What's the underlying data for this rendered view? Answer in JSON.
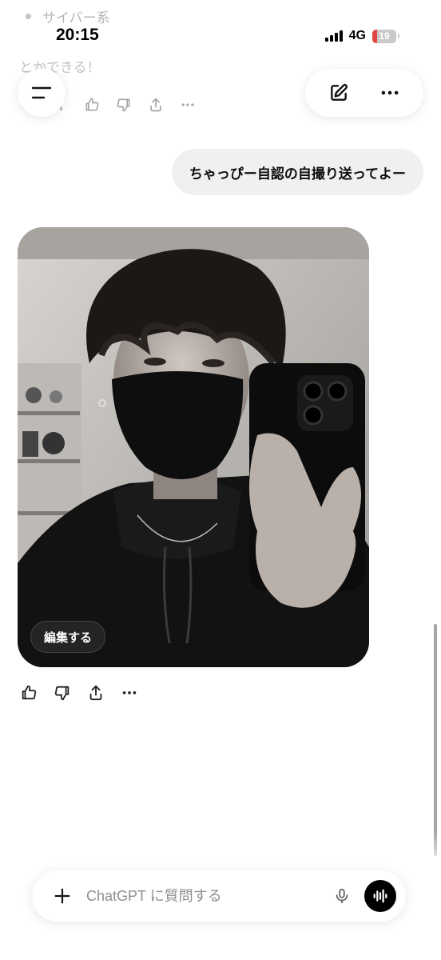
{
  "status": {
    "time": "20:15",
    "network": "4G",
    "battery": "19",
    "battery_level": 0.19,
    "battery_color": "#e04545"
  },
  "previous_message": {
    "bullet_text": "サイバー系",
    "tail_text": "とかできる！"
  },
  "header": {
    "menu_icon": "menu-icon",
    "new_chat_icon": "new-chat-icon",
    "more_icon": "more-icon"
  },
  "conversation": {
    "user_message": "ちゃっぴー自認の自撮り送ってよー",
    "image": {
      "description_icon": "generated-selfie-image",
      "edit_label": "編集する"
    },
    "actions": [
      "thumbs-up-icon",
      "thumbs-down-icon",
      "share-icon",
      "more-icon"
    ]
  },
  "composer": {
    "placeholder": "ChatGPT に質問する",
    "value": "",
    "plus_icon": "plus-icon",
    "mic_icon": "mic-icon",
    "voice_icon": "voice-mode-icon"
  },
  "colors": {
    "bubble_bg": "#f0f0f0",
    "text": "#0d0d0d",
    "placeholder": "#8e8e8e"
  }
}
